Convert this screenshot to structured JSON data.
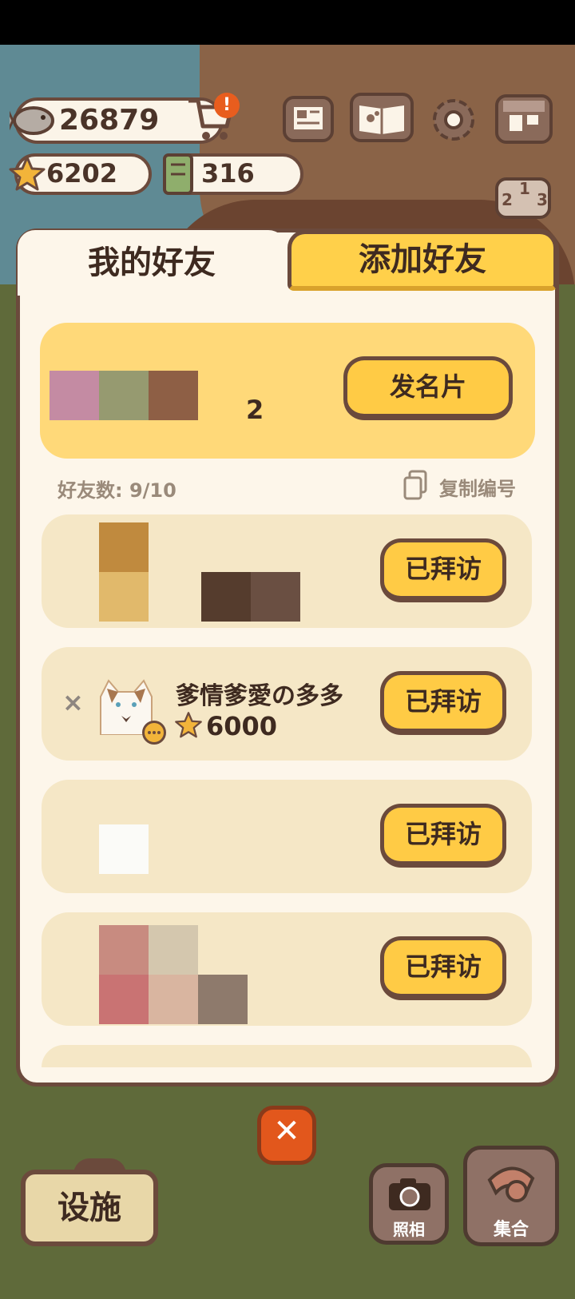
{
  "currencies": {
    "fish": "26879",
    "stars": "6202",
    "tickets": "316",
    "shop_alert": "!"
  },
  "tabs": {
    "my_friends": "我的好友",
    "add_friend": "添加好友"
  },
  "my_card": {
    "id_suffix": "2",
    "send_card_label": "发名片"
  },
  "friend_count_label": "好友数: 9/10",
  "copy_id_label": "复制编号",
  "friends": [
    {
      "name": "",
      "score": "",
      "status": "已拜访"
    },
    {
      "name": "爹情爹愛の多多",
      "score": "6000",
      "status": "已拜访"
    },
    {
      "name": "",
      "score": "",
      "status": "已拜访"
    },
    {
      "name": "",
      "score": "",
      "status": "已拜访"
    }
  ],
  "remove_glyph": "×",
  "bottom": {
    "facility_label": "设施",
    "camera_label": "照相",
    "gather_label": "集合",
    "close_glyph": "✕"
  },
  "ranking_digits": {
    "first": "1",
    "second": "2",
    "third": "3"
  },
  "colors": {
    "accent": "#ffcb45",
    "outline": "#6b4a3c",
    "panel": "#fdf6ea"
  }
}
